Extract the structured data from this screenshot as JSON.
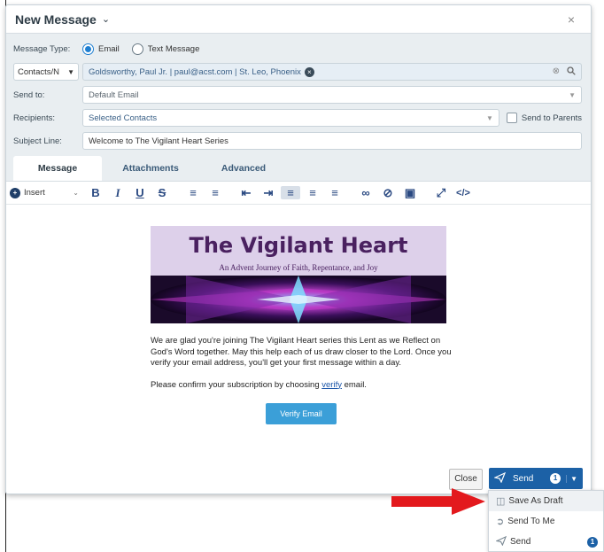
{
  "dialog": {
    "title": "New Message",
    "close_symbol": "×"
  },
  "message_type": {
    "label": "Message Type:",
    "options": [
      "Email",
      "Text Message"
    ],
    "selected": "Email"
  },
  "contacts": {
    "selector": "Contacts/N",
    "value": "Goldsworthy, Paul Jr. | paul@acst.com | St. Leo, Phoenix"
  },
  "send_to": {
    "label": "Send to:",
    "value": "Default Email"
  },
  "recipients": {
    "label": "Recipients:",
    "value": "Selected Contacts",
    "send_to_parents": "Send to Parents"
  },
  "subject": {
    "label": "Subject Line:",
    "value": "Welcome to The Vigilant Heart Series"
  },
  "tabs": [
    {
      "label": "Message",
      "active": true
    },
    {
      "label": "Attachments",
      "active": false
    },
    {
      "label": "Advanced",
      "active": false
    }
  ],
  "toolbar": {
    "insert_label": "Insert",
    "buttons": [
      "B",
      "I",
      "U",
      "S",
      "ordered-list",
      "unordered-list",
      "outdent",
      "indent",
      "align-left",
      "align-center",
      "align-right",
      "link",
      "unlink",
      "image",
      "fullscreen",
      "source"
    ]
  },
  "email": {
    "banner_title": "The Vigilant Heart",
    "banner_subtitle": "An Advent Journey of Faith, Repentance, and Joy",
    "paragraph1": "We are glad you're joining The Vigilant Heart series this Lent as we Reflect on God's Word together. May this help each of us draw closer to the Lord. Once you verify your email address, you'll get your first message within a day.",
    "paragraph2_before": "Please confirm your subscription by choosing ",
    "paragraph2_link": "verify",
    "paragraph2_after": " email.",
    "verify_button": "Verify Email"
  },
  "footer": {
    "close_label": "Close",
    "send_label": "Send",
    "send_badge": "1"
  },
  "send_menu": [
    {
      "label": "Save As Draft",
      "icon": "save-icon",
      "highlighted": true
    },
    {
      "label": "Send To Me",
      "icon": "share-icon",
      "highlighted": false
    },
    {
      "label": "Send",
      "icon": "send-icon",
      "badge": "1",
      "highlighted": false
    }
  ],
  "colors": {
    "accent": "#1c61a6",
    "verify_button": "#3b9fd8",
    "arrow": "#e3191d",
    "banner_text": "#4a2160"
  }
}
